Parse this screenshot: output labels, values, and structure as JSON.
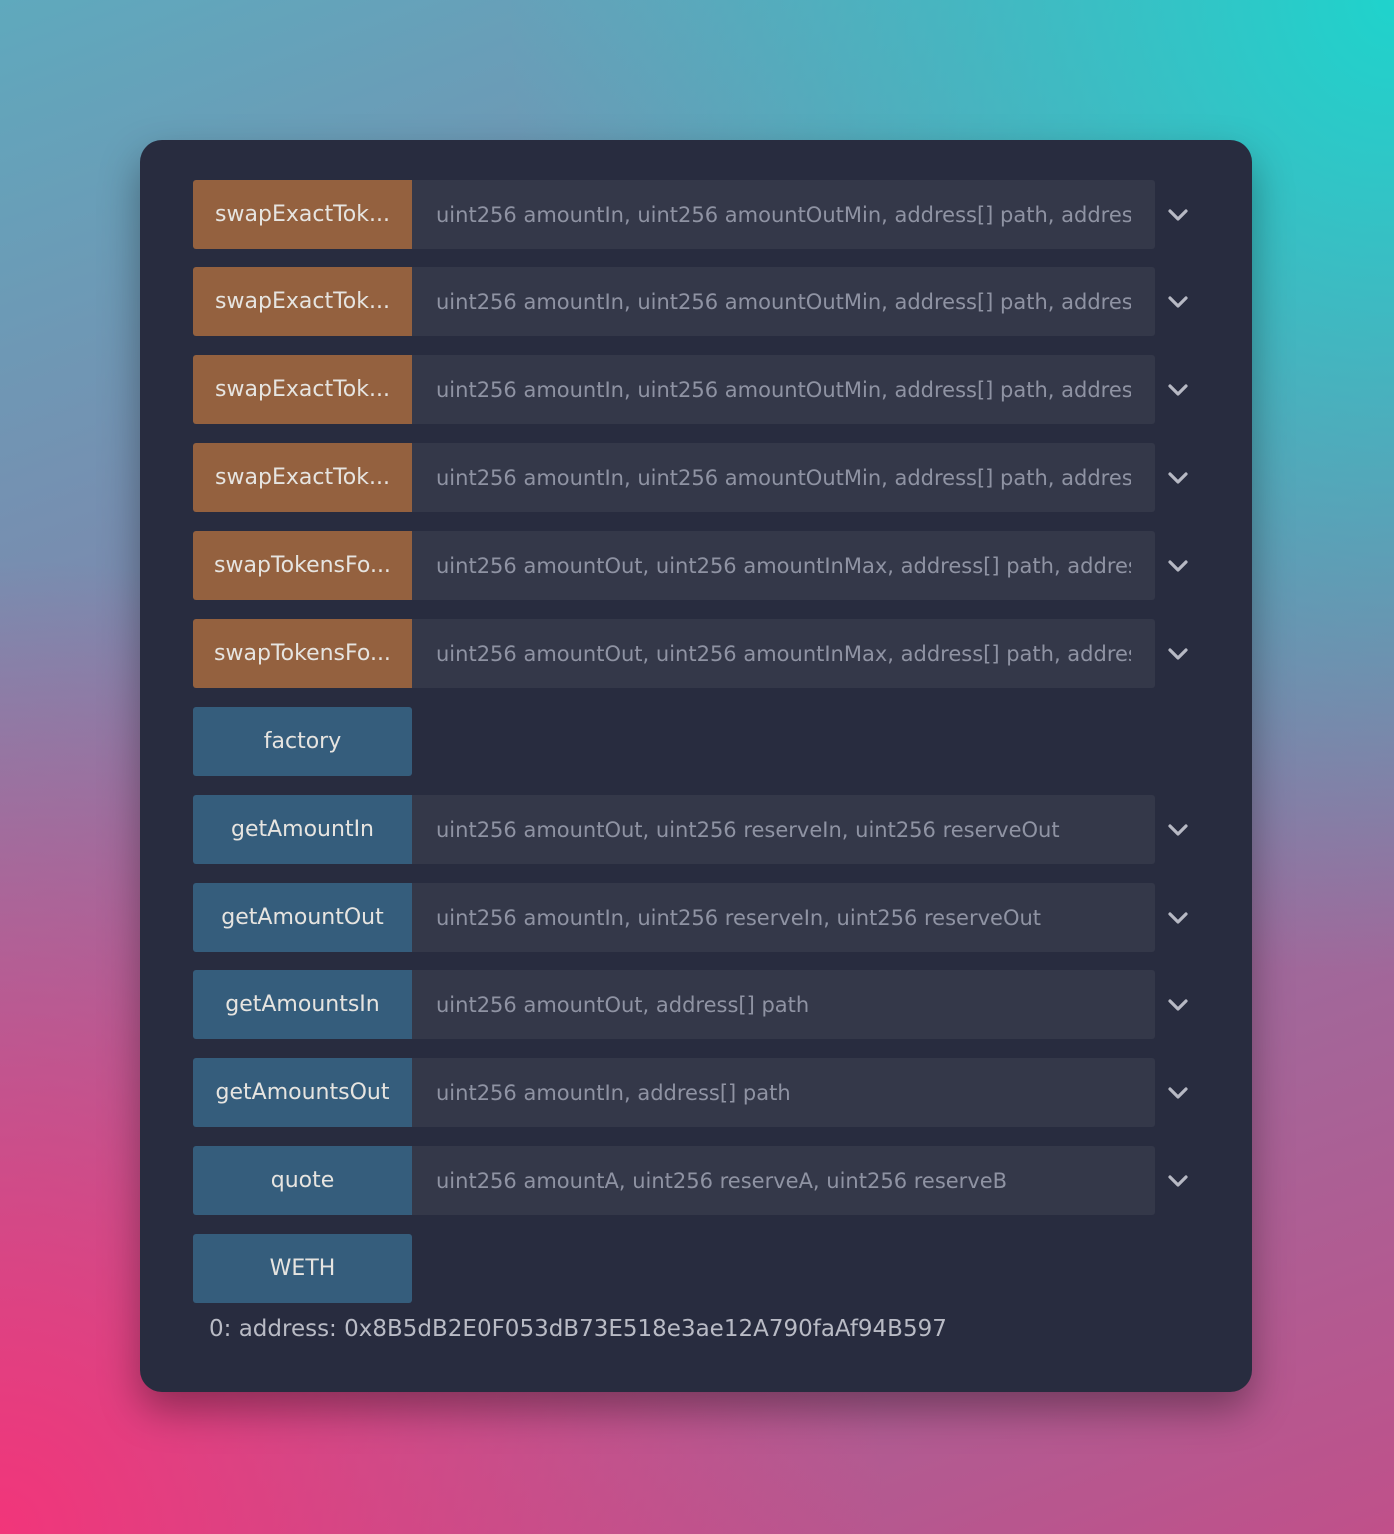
{
  "functions": [
    {
      "label": "swapExactTok...",
      "params": "uint256 amountIn, uint256 amountOutMin, address[] path, address to,",
      "kind": "transact"
    },
    {
      "label": "swapExactTok...",
      "params": "uint256 amountIn, uint256 amountOutMin, address[] path, address to,",
      "kind": "transact"
    },
    {
      "label": "swapExactTok...",
      "params": "uint256 amountIn, uint256 amountOutMin, address[] path, address to,",
      "kind": "transact"
    },
    {
      "label": "swapExactTok...",
      "params": "uint256 amountIn, uint256 amountOutMin, address[] path, address to,",
      "kind": "transact"
    },
    {
      "label": "swapTokensFo...",
      "params": "uint256 amountOut, uint256 amountInMax, address[] path, address to",
      "kind": "transact"
    },
    {
      "label": "swapTokensFo...",
      "params": "uint256 amountOut, uint256 amountInMax, address[] path, address to",
      "kind": "transact"
    },
    {
      "label": "factory",
      "params": "",
      "kind": "call"
    },
    {
      "label": "getAmountIn",
      "params": "uint256 amountOut, uint256 reserveIn, uint256 reserveOut",
      "kind": "call"
    },
    {
      "label": "getAmountOut",
      "params": "uint256 amountIn, uint256 reserveIn, uint256 reserveOut",
      "kind": "call"
    },
    {
      "label": "getAmountsIn",
      "params": "uint256 amountOut, address[] path",
      "kind": "call"
    },
    {
      "label": "getAmountsOut",
      "params": "uint256 amountIn, address[] path",
      "kind": "call"
    },
    {
      "label": "quote",
      "params": "uint256 amountA, uint256 reserveA, uint256 reserveB",
      "kind": "call"
    },
    {
      "label": "WETH",
      "params": "",
      "kind": "call"
    }
  ],
  "output": "0: address: 0x8B5dB2E0F053dB73E518e3ae12A790faAf94B597",
  "icons": {
    "expand": "chevron-down-icon"
  },
  "colors": {
    "transact_button": "#94613f",
    "call_button": "#355d7c",
    "panel": "#282c3f",
    "input": "#343849"
  }
}
